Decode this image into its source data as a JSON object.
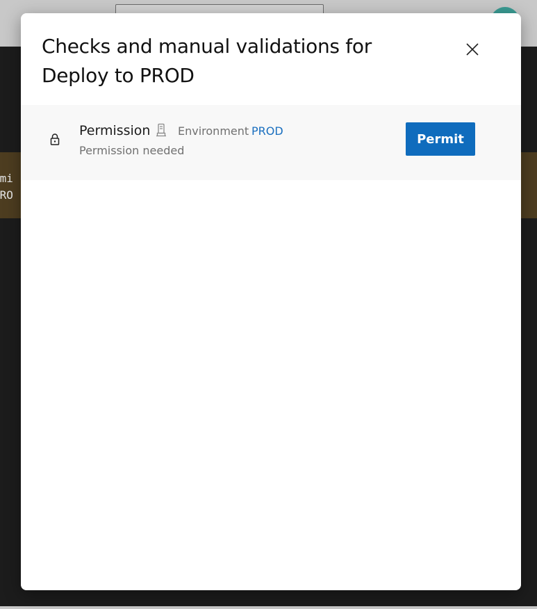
{
  "background": {
    "banner_line_1": "rmi",
    "banner_line_2": "PRO"
  },
  "dialog": {
    "title": "Checks and manual validations for Deploy to PROD",
    "close_icon": "close-icon"
  },
  "checks": [
    {
      "name": "Permission",
      "icon": "lock-icon",
      "resource_icon": "environment-icon",
      "resource_type": "Environment",
      "resource_name": "PROD",
      "status": "Permission needed",
      "action_label": "Permit"
    }
  ],
  "colors": {
    "accent": "#0f6cbd",
    "link": "#1a6fbf",
    "overlay": "#1c1c1c",
    "banner": "#4d3d20",
    "row_background": "#f8f8f8"
  }
}
